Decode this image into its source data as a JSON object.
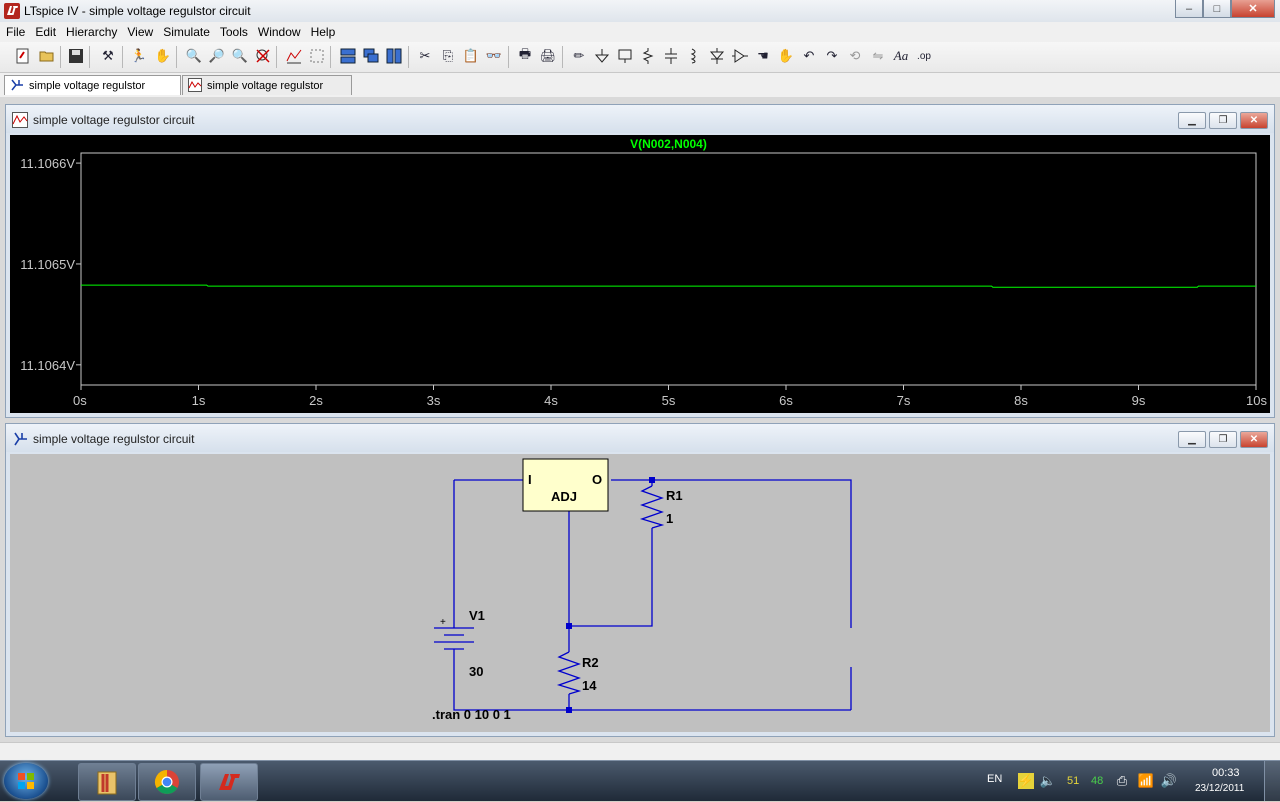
{
  "window": {
    "title": "LTspice IV - simple voltage regulstor circuit",
    "min_label": "–",
    "max_label": "□",
    "close_label": "✕"
  },
  "menu": [
    "File",
    "Edit",
    "Hierarchy",
    "View",
    "Simulate",
    "Tools",
    "Window",
    "Help"
  ],
  "toolbar": [
    "new-schematic",
    "open",
    "save",
    "control-panel",
    "run",
    "halt",
    "zoom-in",
    "pan",
    "zoom-out",
    "zoom-cancel",
    "autorange",
    "autorange-y",
    "tile-horizontal",
    "cascade",
    "tile-vertical",
    "cut",
    "copy",
    "paste",
    "find",
    "print-setup",
    "print",
    "wire",
    "ground",
    "label-net",
    "resistor",
    "capacitor",
    "inductor",
    "diode",
    "component",
    "move",
    "drag",
    "undo",
    "redo",
    "rotate",
    "mirror",
    "text",
    "spice-directive"
  ],
  "tabs": [
    {
      "label": "simple voltage regulstor circuit",
      "icon": "schematic-icon",
      "active": true
    },
    {
      "label": "simple voltage regulstor circuit",
      "icon": "waveform-icon",
      "active": false
    }
  ],
  "plot_window": {
    "title": "simple voltage regulstor circuit",
    "trace_color": "#00ff00"
  },
  "chart_data": {
    "type": "line",
    "title": "V(N002,N004)",
    "xlabel": "",
    "ylabel": "",
    "xlim": [
      0,
      10
    ],
    "ylim": [
      11.10638,
      11.10661
    ],
    "x_ticks": [
      "0s",
      "1s",
      "2s",
      "3s",
      "4s",
      "5s",
      "6s",
      "7s",
      "8s",
      "9s",
      "10s"
    ],
    "y_ticks": [
      {
        "value": 11.1066,
        "label": "11.1066V"
      },
      {
        "value": 11.1065,
        "label": "11.1065V"
      },
      {
        "value": 11.1064,
        "label": "11.1064V"
      }
    ],
    "series": [
      {
        "name": "V(N002,N004)",
        "x": [
          0,
          1.07,
          1.08,
          7.75,
          7.76,
          9.5,
          9.51,
          10
        ],
        "y": [
          11.106479,
          11.106479,
          11.106478,
          11.106478,
          11.106477,
          11.106477,
          11.106478,
          11.106478
        ]
      }
    ],
    "grid": false
  },
  "schematic_window": {
    "title": "simple voltage regulstor circuit",
    "wire_color": "#0000cc",
    "regulator": {
      "in_pin": "I",
      "out_pin": "O",
      "adj_label": "ADJ"
    },
    "r1": {
      "name": "R1",
      "value": "1"
    },
    "r2": {
      "name": "R2",
      "value": "14"
    },
    "v1": {
      "name": "V1",
      "value": "30",
      "plus": "+"
    },
    "directive": ".tran 0 10 0 1"
  },
  "taskbar": {
    "apps": [
      "windows-explorer",
      "google-chrome",
      "ltspice"
    ],
    "language": "EN",
    "tray_value_1": "51",
    "tray_value_2": "48",
    "time": "00:33",
    "date": "23/12/2011"
  }
}
